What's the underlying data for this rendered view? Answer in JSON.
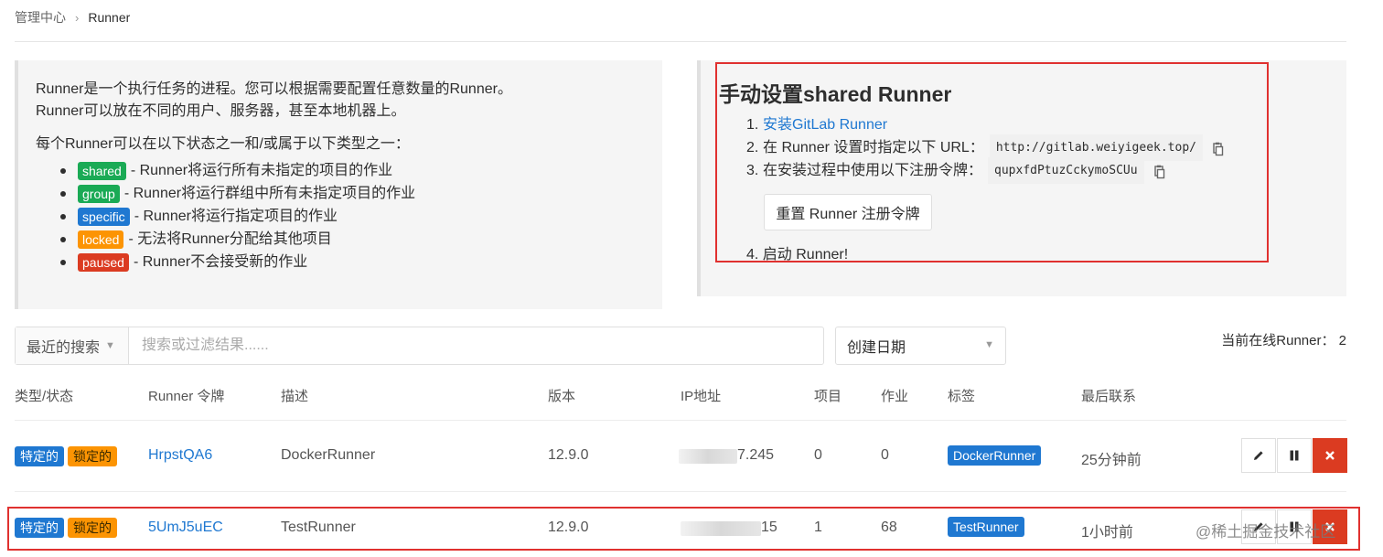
{
  "breadcrumb": {
    "parent": "管理中心",
    "current": "Runner"
  },
  "intro": {
    "line1": "Runner是一个执行任务的进程。您可以根据需要配置任意数量的Runner。",
    "line2": "Runner可以放在不同的用户、服务器，甚至本地机器上。",
    "status_intro": "每个Runner可以在以下状态之一和/或属于以下类型之一：",
    "types": [
      {
        "badge": "shared",
        "text": "- Runner将运行所有未指定的项目的作业"
      },
      {
        "badge": "group",
        "text": "- Runner将运行群组中所有未指定项目的作业"
      },
      {
        "badge": "specific",
        "text": "- Runner将运行指定项目的作业"
      },
      {
        "badge": "locked",
        "text": "- 无法将Runner分配给其他项目"
      },
      {
        "badge": "paused",
        "text": "- Runner不会接受新的作业"
      }
    ]
  },
  "setup": {
    "title": "手动设置shared Runner",
    "step1_num": "1.",
    "step1_link": "安装GitLab Runner",
    "step2_num": "2.",
    "step2_text": "在 Runner 设置时指定以下 URL：",
    "url": "http://gitlab.weiyigeek.top/",
    "step3_num": "3.",
    "step3_text": "在安装过程中使用以下注册令牌：",
    "token": "qupxfdPtuzCckymoSCUu",
    "reset_button": "重置 Runner 注册令牌",
    "step4": "4. 启动 Runner!"
  },
  "filter": {
    "recent_label": "最近的搜索",
    "search_placeholder": "搜索或过滤结果......",
    "sort_label": "创建日期",
    "online_label": "当前在线Runner： 2"
  },
  "table": {
    "headers": [
      "类型/状态",
      "Runner 令牌",
      "描述",
      "版本",
      "IP地址",
      "项目",
      "作业",
      "标签",
      "最后联系"
    ],
    "rows": [
      {
        "type": "特定的",
        "state": "锁定的",
        "token": "HrpstQA6",
        "description": "DockerRunner",
        "version": "12.9.0",
        "ip_tail": "7.245",
        "projects": "0",
        "jobs": "0",
        "tag": "DockerRunner",
        "last_contact": "25分钟前"
      },
      {
        "type": "特定的",
        "state": "锁定的",
        "token": "5UmJ5uEC",
        "description": "TestRunner",
        "version": "12.9.0",
        "ip_tail": "15",
        "projects": "1",
        "jobs": "68",
        "tag": "TestRunner",
        "last_contact": "1小时前"
      }
    ]
  },
  "watermark": "@稀土掘金技术社区",
  "colors": {
    "link": "#1f78d1",
    "success": "#1aaa55",
    "warning": "#fc9403",
    "danger": "#db3b21",
    "highlight": "#e0312f"
  },
  "icons": [
    "chevron-right-icon",
    "chevron-down-icon",
    "copy-icon",
    "pencil-icon",
    "pause-icon",
    "close-icon"
  ]
}
